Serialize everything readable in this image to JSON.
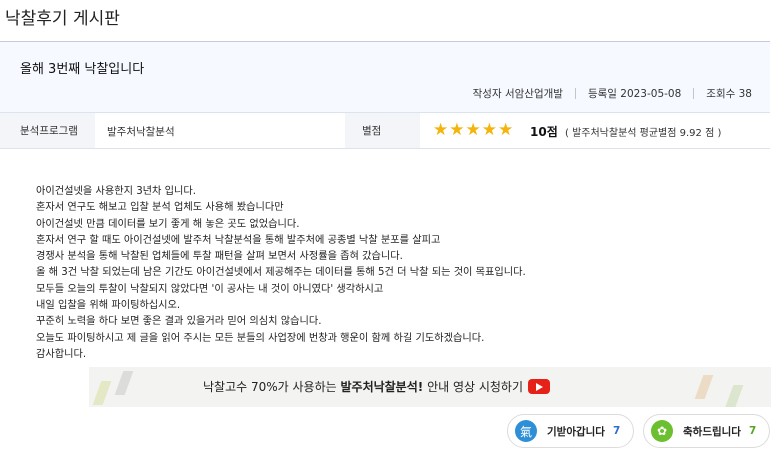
{
  "board": {
    "title": "낙찰후기 게시판"
  },
  "post": {
    "title": "올해 3번째 낙찰입니다",
    "meta": {
      "author_label": "작성자",
      "author": "서암산업개발",
      "date_label": "등록일",
      "date": "2023-05-08",
      "views_label": "조회수",
      "views": "38"
    },
    "program_label": "분석프로그램",
    "program_value": "발주처낙찰분석",
    "rating_label": "별점",
    "rating_stars": 5,
    "rating_score": "10점",
    "rating_avg": "( 발주처낙찰분석 평균별점 9.92 점 )",
    "body": [
      "아이건설넷을 사용한지 3년차 입니다.",
      "혼자서 연구도 해보고 입찰 분석 업체도 사용해 봤습니다만",
      "아이건설넷 만큼 데이터를 보기 좋게 해 놓은 곳도 없었습니다.",
      "혼자서 연구 할 때도 아이건설넷에 발주처 낙찰분석을 통해 발주처에 공종별 낙찰 분포를 살피고",
      "경쟁사 분석을 통해 낙찰된 업체들에 투찰 패턴을 살펴 보면서 사정률을 좁혀 갔습니다.",
      "올 해 3건 낙찰 되었는데 남은 기간도 아이건설넷에서 제공해주는 데이터를 통해 5건 더 낙찰 되는 것이 목표입니다.",
      "모두들 오늘의 투찰이 낙찰되지 않았다면 '이 공사는 내 것이 아니였다' 생각하시고",
      "내일 입찰을 위해 파이팅하십시오.",
      "꾸준히 노력을 하다 보면 좋은 결과 있을거라 믿어 의심치 않습니다.",
      "오늘도 파이팅하시고 제 글을 읽어 주시는 모든 분들의 사업장에 번창과 행운이 함께 하길 기도하겠습니다.",
      "감사합니다."
    ]
  },
  "banner": {
    "text_before": "낙찰고수 70%가 사용하는 ",
    "text_bold": "발주처낙찰분석!",
    "text_after": " 안내 영상 시청하기",
    "icon": "youtube-play-icon"
  },
  "reactions": [
    {
      "icon": "energy-icon",
      "icon_glyph": "氣",
      "label": "기받아갑니다",
      "count": "7",
      "color": "#2f8fd6"
    },
    {
      "icon": "party-popper-icon",
      "icon_glyph": "✿",
      "label": "축하드립니다",
      "count": "7",
      "color": "#6cbf2f"
    }
  ],
  "colors": {
    "star": "#f5b40c",
    "header_bg": "#f6f9ff",
    "count_blue": "#2f6fd0",
    "count_green": "#5aa624",
    "youtube_red": "#e62117"
  }
}
